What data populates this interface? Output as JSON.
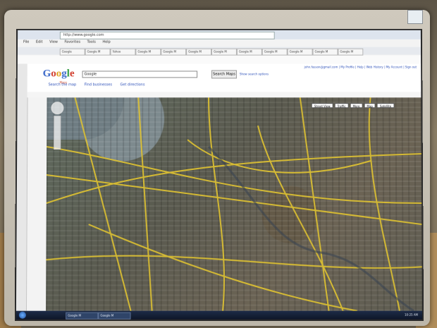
{
  "browser": {
    "url": "http://www.google.com",
    "menu": [
      "File",
      "Edit",
      "View",
      "Favorites",
      "Tools",
      "Help"
    ],
    "tabs": [
      "Google",
      "Google M",
      "Yahoo",
      "Google M",
      "Google M",
      "Google M",
      "Google M",
      "Google M",
      "Google M",
      "Google M",
      "Google M",
      "Google M"
    ]
  },
  "gmaps": {
    "logo_sub": "Maps",
    "search_value": "Google",
    "search_button": "Search Maps",
    "search_options": "Show search options",
    "account": "john.fasson@gmail.com | My Profile | Help | Web History | My Account | Sign out",
    "subtabs": [
      "Search the map",
      "Find businesses",
      "Get directions"
    ],
    "map_types": [
      "Street View",
      "Traffic",
      "More",
      "Map",
      "Satellite"
    ]
  },
  "taskbar": {
    "items": [
      "Google M",
      "Google M"
    ],
    "clock": "10:25 AM"
  },
  "colors": {
    "road": "#e1c431",
    "highway": "#e8b93a"
  }
}
